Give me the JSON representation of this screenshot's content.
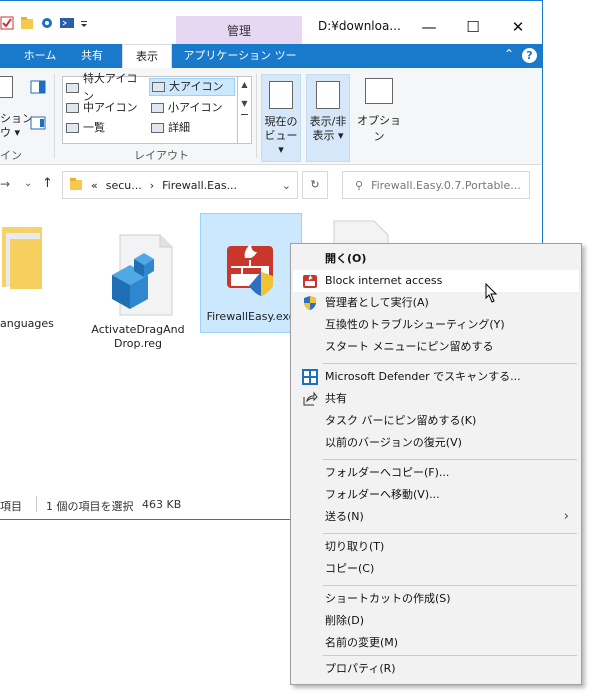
{
  "window": {
    "context_tab": "管理",
    "title": "D:¥downloa...",
    "controls": {
      "minimize": "—",
      "maximize": "☐",
      "close": "✕"
    }
  },
  "ribbon_tabs": {
    "home": "ホーム",
    "share": "共有",
    "view": "表示",
    "app_tools": "アプリケーション ツール",
    "collapse": "⌃",
    "help": "?"
  },
  "ribbon": {
    "left_partial_1": "ション",
    "left_partial_2": "ウ ▾",
    "left_group_partial": "イン",
    "layout": {
      "extra_large": "特大アイコン",
      "large": "大アイコン",
      "medium": "中アイコン",
      "small": "小アイコン",
      "list": "一覧",
      "details": "詳細",
      "group": "レイアウト"
    },
    "current_view": {
      "line1": "現在の",
      "line2": "ビュー ▾"
    },
    "show_hide": {
      "line1": "表示/非",
      "line2": "表示 ▾"
    },
    "options": "オプション"
  },
  "address": {
    "path_prefix": "«",
    "seg1": "secu...",
    "sep": "›",
    "seg2": "Firewall.Eas...",
    "search_placeholder": "Firewall.Easy.0.7.Portable..."
  },
  "files": [
    {
      "name": "anguages"
    },
    {
      "name": "ActivateDragAnd\nDrop.reg"
    },
    {
      "name": "FirewallEasy.exe"
    }
  ],
  "status": {
    "items_partial": "項目",
    "selection": "1 個の項目を選択",
    "size": "463 KB"
  },
  "context_menu": {
    "open": "開く(O)",
    "block": "Block internet access",
    "run_as_admin": "管理者として実行(A)",
    "troubleshoot": "互換性のトラブルシューティング(Y)",
    "pin_start": "スタート メニューにピン留めする",
    "defender": "Microsoft Defender でスキャンする...",
    "share": "共有",
    "pin_taskbar": "タスク バーにピン留めする(K)",
    "restore_prev": "以前のバージョンの復元(V)",
    "copy_to": "フォルダーへコピー(F)...",
    "move_to": "フォルダーへ移動(V)...",
    "send_to": "送る(N)",
    "cut": "切り取り(T)",
    "copy": "コピー(C)",
    "create_shortcut": "ショートカットの作成(S)",
    "delete": "削除(D)",
    "rename": "名前の変更(M)",
    "properties": "プロパティ(R)"
  },
  "colors": {
    "accent": "#1979ca",
    "selection": "#cce8ff",
    "manage_tab": "#e6d8f3",
    "menu_bg": "#f2f2f2"
  }
}
